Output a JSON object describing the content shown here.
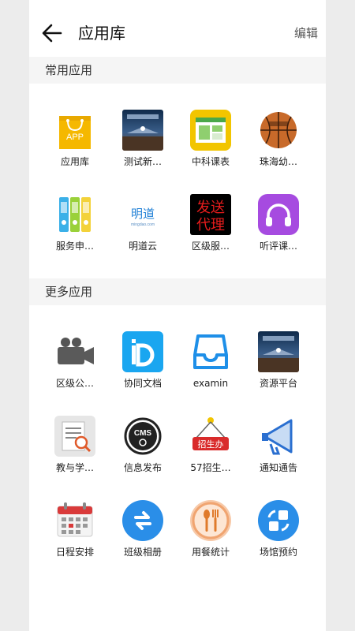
{
  "header": {
    "title": "应用库",
    "edit": "编辑"
  },
  "sections": [
    {
      "title": "常用应用",
      "apps": [
        {
          "label": "应用库",
          "icon": "app-bag-icon",
          "badge": "APP"
        },
        {
          "label": "测试新…",
          "icon": "concert-photo-icon"
        },
        {
          "label": "中科课表",
          "icon": "timetable-icon"
        },
        {
          "label": "珠海幼…",
          "icon": "basketball-icon"
        },
        {
          "label": "服务申…",
          "icon": "binders-icon"
        },
        {
          "label": "明道云",
          "icon": "mingdao-logo-icon",
          "logo_text": "明道",
          "logo_sub": "mingdao.com"
        },
        {
          "label": "区级服…",
          "icon": "send-agent-icon",
          "sign_line1": "发送",
          "sign_line2": "代理"
        },
        {
          "label": "听评课…",
          "icon": "headphones-icon"
        }
      ]
    },
    {
      "title": "更多应用",
      "apps": [
        {
          "label": "区级公…",
          "icon": "camera-icon"
        },
        {
          "label": "协同文档",
          "icon": "collab-doc-icon"
        },
        {
          "label": "examin",
          "icon": "inbox-tray-icon"
        },
        {
          "label": "资源平台",
          "icon": "concert-photo-icon"
        },
        {
          "label": "教与学…",
          "icon": "document-search-icon"
        },
        {
          "label": "信息发布",
          "icon": "cms-icon",
          "logo_text": "CMS"
        },
        {
          "label": "57招生…",
          "icon": "enroll-sign-icon",
          "sign_text": "招生办"
        },
        {
          "label": "通知通告",
          "icon": "megaphone-icon"
        },
        {
          "label": "日程安排",
          "icon": "calendar-icon"
        },
        {
          "label": "班级相册",
          "icon": "exchange-icon"
        },
        {
          "label": "用餐统计",
          "icon": "utensils-icon"
        },
        {
          "label": "场馆预约",
          "icon": "venue-booking-icon"
        }
      ]
    }
  ]
}
